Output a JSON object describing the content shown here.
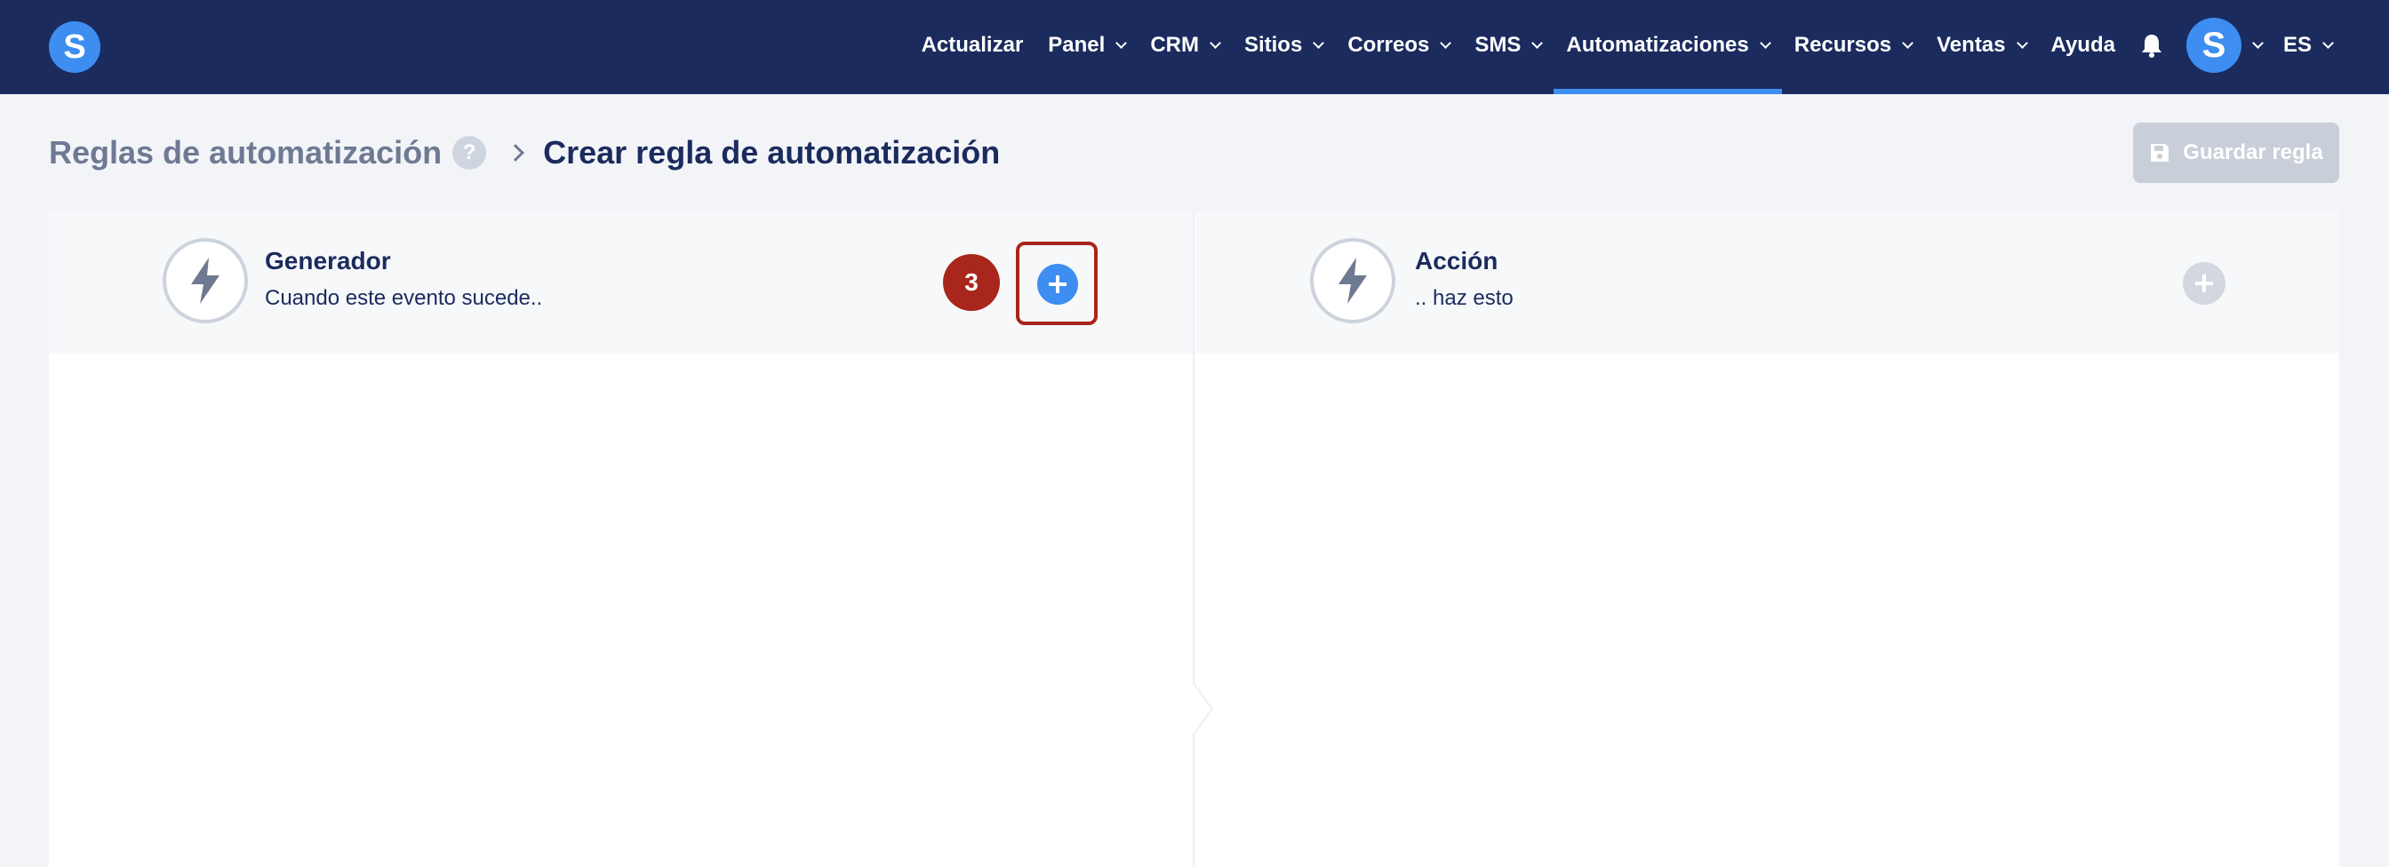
{
  "nav": {
    "logo_letter": "S",
    "items": [
      {
        "label": "Actualizar",
        "dropdown": false
      },
      {
        "label": "Panel",
        "dropdown": true
      },
      {
        "label": "CRM",
        "dropdown": true
      },
      {
        "label": "Sitios",
        "dropdown": true
      },
      {
        "label": "Correos",
        "dropdown": true
      },
      {
        "label": "SMS",
        "dropdown": true
      },
      {
        "label": "Automatizaciones",
        "dropdown": true,
        "active": true
      },
      {
        "label": "Recursos",
        "dropdown": true
      },
      {
        "label": "Ventas",
        "dropdown": true
      },
      {
        "label": "Ayuda",
        "dropdown": false
      }
    ],
    "bell_icon": "bell-icon",
    "avatar_letter": "S",
    "language": "ES"
  },
  "header": {
    "breadcrumb_parent": "Reglas de automatización",
    "help_symbol": "?",
    "current": "Crear regla de automatización",
    "save_label": "Guardar regla"
  },
  "trigger": {
    "title": "Generador",
    "subtitle": "Cuando este evento sucede..",
    "step_number": "3",
    "icon": "lightning-icon"
  },
  "action": {
    "title": "Acción",
    "subtitle": ".. haz esto",
    "icon": "lightning-refresh-icon"
  },
  "colors": {
    "nav_bg": "#1b2b5e",
    "accent": "#3d8ef0",
    "highlight": "#a8261b",
    "disabled": "#c9cfd8"
  }
}
